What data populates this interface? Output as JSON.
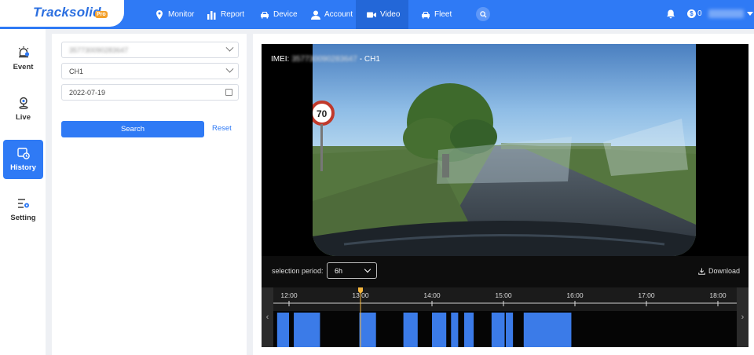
{
  "app": {
    "logo_text": "Tracksolid",
    "logo_badge": "Pro"
  },
  "nav": {
    "items": [
      {
        "label": "Monitor",
        "icon": "location-pin-icon",
        "active": false
      },
      {
        "label": "Report",
        "icon": "bar-chart-icon",
        "active": false
      },
      {
        "label": "Device",
        "icon": "car-icon",
        "active": false
      },
      {
        "label": "Account",
        "icon": "user-icon",
        "active": false
      },
      {
        "label": "Video",
        "icon": "video-camera-icon",
        "active": true
      },
      {
        "label": "Fleet",
        "icon": "fleet-car-icon",
        "active": false
      }
    ],
    "search_icon": "search-icon",
    "bell_icon": "bell-icon",
    "coin_symbol": "$",
    "coin_count": "0"
  },
  "rail": {
    "items": [
      {
        "label": "Event",
        "icon": "event-alarm-icon",
        "active": false
      },
      {
        "label": "Live",
        "icon": "live-pin-icon",
        "active": false
      },
      {
        "label": "History",
        "icon": "history-clock-icon",
        "active": true
      },
      {
        "label": "Setting",
        "icon": "settings-sliders-icon",
        "active": false
      }
    ]
  },
  "filter": {
    "device_value": "357730090283647",
    "channel_value": "CH1",
    "date_value": "2022-07-19",
    "search_label": "Search",
    "reset_label": "Reset"
  },
  "player": {
    "imei_prefix": "IMEI:",
    "imei_value": "357730090283647",
    "imei_suffix": "- CH1",
    "selection_label": "selection period:",
    "selection_value": "6h",
    "download_label": "Download",
    "colors": {
      "accent": "#2f7af5",
      "segment": "#3b7be8",
      "marker": "#f5b63d"
    }
  },
  "timeline": {
    "ticks": [
      "12:00",
      "13:00",
      "14:00",
      "15:00",
      "16:00",
      "17:00",
      "18:00"
    ],
    "range_start": "12:00",
    "range_hours": 6.6,
    "marker_time": "13:00",
    "segments": [
      {
        "start": "11:50",
        "end": "12:00"
      },
      {
        "start": "12:04",
        "end": "12:26"
      },
      {
        "start": "12:59",
        "end": "13:13"
      },
      {
        "start": "13:36",
        "end": "13:48"
      },
      {
        "start": "14:00",
        "end": "14:12"
      },
      {
        "start": "14:16",
        "end": "14:22"
      },
      {
        "start": "14:27",
        "end": "14:35"
      },
      {
        "start": "14:50",
        "end": "15:01"
      },
      {
        "start": "15:02",
        "end": "15:08"
      },
      {
        "start": "15:17",
        "end": "15:57"
      }
    ]
  }
}
